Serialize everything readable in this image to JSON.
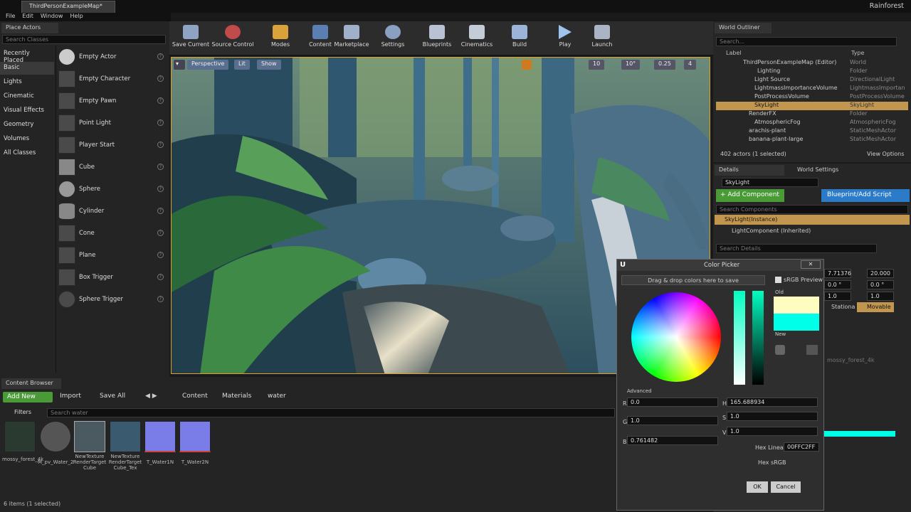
{
  "window": {
    "tab": "ThirdPersonExampleMap*",
    "project": "Rainforest"
  },
  "menu": [
    "File",
    "Edit",
    "Window",
    "Help"
  ],
  "place": {
    "title": "Place Actors",
    "search_placeholder": "Search Classes",
    "categories": [
      "Recently Placed",
      "Basic",
      "Lights",
      "Cinematic",
      "Visual Effects",
      "Geometry",
      "Volumes",
      "All Classes"
    ],
    "actors": [
      "Empty Actor",
      "Empty Character",
      "Empty Pawn",
      "Point Light",
      "Player Start",
      "Cube",
      "Sphere",
      "Cylinder",
      "Cone",
      "Plane",
      "Box Trigger",
      "Sphere Trigger"
    ]
  },
  "toolbar": [
    "Save Current",
    "Source Control",
    "Modes",
    "Content",
    "Marketplace",
    "Settings",
    "Blueprints",
    "Cinematics",
    "Build",
    "Play",
    "Launch"
  ],
  "viewport": {
    "perspective": "Perspective",
    "lit": "Lit",
    "show": "Show",
    "grid": "10",
    "angle": "10°",
    "scale": "0.25",
    "cam": "4"
  },
  "content": {
    "title": "Content Browser",
    "add_new": "Add New",
    "import": "Import",
    "save_all": "Save All",
    "path": [
      "Content",
      "Materials",
      "water"
    ],
    "filters": "Filters",
    "search": "Search water",
    "items": [
      "mossy_forest_4k",
      "M_pv_Water_2",
      "NewTexture RenderTarget Cube",
      "NewTexture RenderTarget Cube_Tex",
      "T_Water1N",
      "T_Water2N"
    ],
    "status": "6 items (1 selected)"
  },
  "outliner": {
    "title": "World Outliner",
    "search": "Search...",
    "col_label": "Label",
    "col_type": "Type",
    "rows": [
      [
        "ThirdPersonExampleMap (Editor)",
        "World"
      ],
      [
        "Lighting",
        "Folder"
      ],
      [
        "Light Source",
        "DirectionalLight"
      ],
      [
        "LightmassImportanceVolume",
        "LightmassImportan"
      ],
      [
        "PostProcessVolume",
        "PostProcessVolume"
      ],
      [
        "SkyLight",
        "SkyLight"
      ],
      [
        "RenderFX",
        "Folder"
      ],
      [
        "AtmosphericFog",
        "AtmosphericFog"
      ],
      [
        "arachis-plant",
        "StaticMeshActor"
      ],
      [
        "banana-plant-large",
        "StaticMeshActor"
      ]
    ],
    "count": "402 actors (1 selected)",
    "view": "View Options"
  },
  "details": {
    "tab1": "Details",
    "tab2": "World Settings",
    "name": "SkyLight",
    "add": "+ Add Component",
    "bp": "Blueprint/Add Script",
    "search_comp": "Search Components",
    "instance": "SkyLight(Instance)",
    "component": "LightComponent (Inherited)",
    "search_details": "Search Details",
    "mobility_stat": "Stationa",
    "mobility_mov": "Movable",
    "cubemap": "mossy_forest_4k",
    "vals": [
      "7.71376",
      "20.000",
      "0.0 °",
      "0.0 °",
      "1.0",
      "1.0"
    ]
  },
  "picker": {
    "title": "Color Picker",
    "drag": "Drag & drop colors here to save",
    "srgb": "sRGB Preview",
    "old": "Old",
    "new": "New",
    "advanced": "Advanced",
    "R": "0.0",
    "G": "1.0",
    "B": "0.761482",
    "H": "165.688934",
    "S": "1.0",
    "V": "1.0",
    "hex_lin": "Hex Linear",
    "hex_lin_val": "00FFC2FF",
    "hex_srgb": "Hex sRGB",
    "ok": "OK",
    "cancel": "Cancel",
    "old_color": "#fffcc0",
    "new_color": "#00ffe8"
  }
}
